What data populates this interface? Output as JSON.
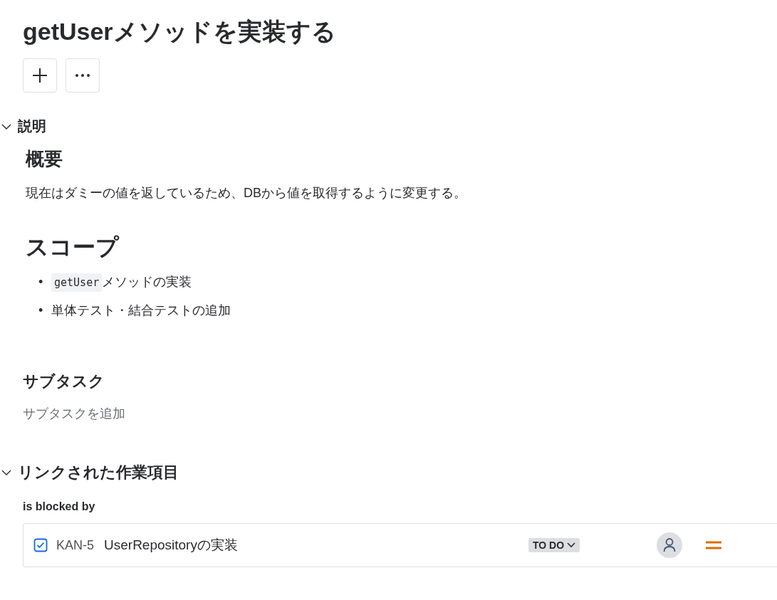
{
  "title": "getUserメソッドを実装する",
  "toolbar": [
    {
      "kind": "add"
    },
    {
      "kind": "more"
    }
  ],
  "description": {
    "label": "説明",
    "expanded": true,
    "blocks": [
      {
        "kind": "h2",
        "text": "概要"
      },
      {
        "kind": "p",
        "text": "現在はダミーの値を返しているため、DBから値を取得するように変更する。"
      },
      {
        "kind": "h1",
        "text": "スコープ"
      },
      {
        "kind": "list",
        "items": [
          {
            "marker": "•",
            "code": "getUser",
            "text": "メソッドの実装"
          },
          {
            "marker": "•",
            "text": "単体テスト・結合テストの追加"
          }
        ]
      }
    ]
  },
  "subtasks": {
    "label": "サブタスク",
    "add_label": "サブタスクを追加"
  },
  "linked": {
    "label": "リンクされた作業項目",
    "expanded": true,
    "groups": [
      {
        "relation": "is blocked by",
        "items": [
          {
            "key": "KAN-5",
            "summary": "UserRepositoryの実装",
            "status": "TO DO",
            "color": "#e06c00"
          }
        ]
      }
    ]
  }
}
